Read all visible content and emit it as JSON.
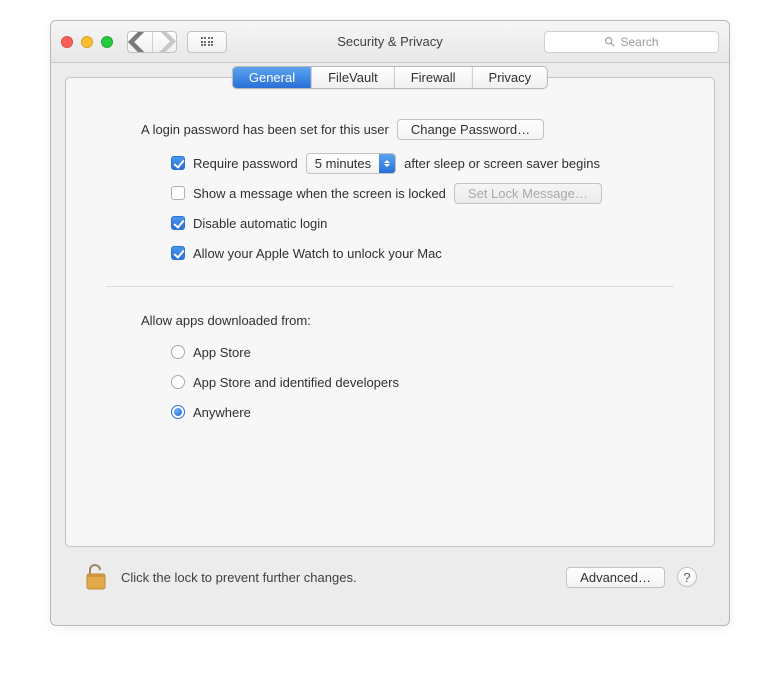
{
  "window": {
    "title": "Security & Privacy"
  },
  "search": {
    "placeholder": "Search"
  },
  "tabs": {
    "general": "General",
    "filevault": "FileVault",
    "firewall": "Firewall",
    "privacy": "Privacy"
  },
  "login": {
    "text": "A login password has been set for this user",
    "change_btn": "Change Password…",
    "require_label": "Require password",
    "require_after": "after sleep or screen saver begins",
    "delay_value": "5 minutes",
    "show_msg_label": "Show a message when the screen is locked",
    "set_msg_btn": "Set Lock Message…",
    "disable_auto_label": "Disable automatic login",
    "watch_label": "Allow your Apple Watch to unlock your Mac"
  },
  "downloads": {
    "heading": "Allow apps downloaded from:",
    "opt1": "App Store",
    "opt2": "App Store and identified developers",
    "opt3": "Anywhere"
  },
  "footer": {
    "lock_text": "Click the lock to prevent further changes.",
    "advanced_btn": "Advanced…",
    "help": "?"
  }
}
